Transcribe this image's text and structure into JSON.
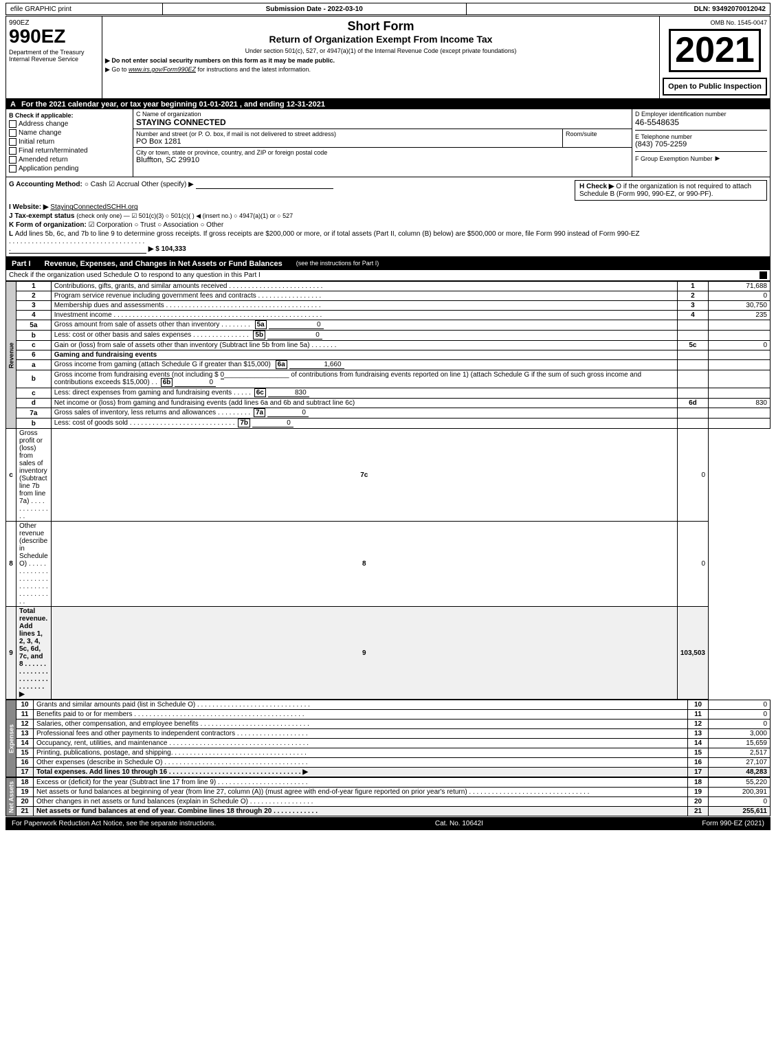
{
  "header": {
    "efile_label": "efile GRAPHIC print",
    "submission_label": "Submission Date - 2022-03-10",
    "dln_label": "DLN: 93492070012042"
  },
  "form_info": {
    "form_number": "990EZ",
    "department": "Department of the Treasury",
    "bureau": "Internal Revenue Service",
    "omb": "OMB No. 1545-0047",
    "year": "2021",
    "title_short": "Short Form",
    "title_long": "Return of Organization Exempt From Income Tax",
    "subtitle": "Under section 501(c), 527, or 4947(a)(1) of the Internal Revenue Code (except private foundations)",
    "note1": "▶ Do not enter social security numbers on this form as it may be made public.",
    "note2": "▶ Go to www.irs.gov/Form990EZ for instructions and the latest information.",
    "open_label": "Open to Public Inspection"
  },
  "section_a": {
    "label": "A",
    "year_text": "For the 2021 calendar year, or tax year beginning 01-01-2021 , and ending 12-31-2021",
    "b_label": "B Check if applicable:",
    "checkboxes": {
      "address_change": "Address change",
      "name_change": "Name change",
      "initial_return": "Initial return",
      "final_return": "Final return/terminated",
      "amended_return": "Amended return",
      "application_pending": "Application pending"
    },
    "c_label": "C Name of organization",
    "org_name": "STAYING CONNECTED",
    "street_label": "Number and street (or P. O. box, if mail is not delivered to street address)",
    "street_value": "PO Box 1281",
    "room_label": "Room/suite",
    "city_label": "City or town, state or province, country, and ZIP or foreign postal code",
    "city_value": "Bluffton, SC  29910",
    "d_label": "D Employer identification number",
    "ein": "46-5548635",
    "e_label": "E Telephone number",
    "phone": "(843) 705-2259",
    "f_label": "F Group Exemption Number",
    "f_arrow": "▶"
  },
  "section_gh": {
    "g_label": "G Accounting Method:",
    "g_cash": "Cash",
    "g_accrual": "Accrual",
    "g_other": "Other (specify) ▶",
    "g_line": "___________________________",
    "h_label": "H  Check ▶",
    "h_text": "O  if the organization is not required to attach Schedule B (Form 990, 990-EZ, or 990-PF).",
    "i_label": "I Website: ▶",
    "i_value": "StayingConnectedSCHH.org",
    "j_label": "J Tax-exempt status",
    "j_text": "(check only one) — ☑ 501(c)(3) ○ 501(c)(    ) ◀ (insert no.) ○ 4947(a)(1) or ○ 527",
    "k_label": "K Form of organization:",
    "k_corp": "☑ Corporation",
    "k_trust": "○ Trust",
    "k_assoc": "○ Association",
    "k_other": "○ Other",
    "l_label": "L",
    "l_text": "Add lines 5b, 6c, and 7b to line 9 to determine gross receipts. If gross receipts are $200,000 or more, or if total assets (Part II, column (B) below) are $500,000 or more, file Form 990 instead of Form 990-EZ",
    "l_value": "▶ $ 104,333"
  },
  "part1": {
    "label": "Part I",
    "title": "Revenue, Expenses, and Changes in Net Assets or Fund Balances",
    "subtitle": "(see the instructions for Part I)",
    "check_text": "Check if the organization used Schedule O to respond to any question in this Part I",
    "rows": [
      {
        "num": "1",
        "desc": "Contributions, gifts, grants, and similar amounts received",
        "col_num": "1",
        "value": "71,688"
      },
      {
        "num": "2",
        "desc": "Program service revenue including government fees and contracts",
        "col_num": "2",
        "value": "0"
      },
      {
        "num": "3",
        "desc": "Membership dues and assessments",
        "col_num": "3",
        "value": "30,750"
      },
      {
        "num": "4",
        "desc": "Investment income",
        "col_num": "4",
        "value": "235"
      },
      {
        "num": "5a",
        "desc": "Gross amount from sale of assets other than inventory",
        "sub_label": "5a",
        "sub_value": "0",
        "col_num": "",
        "value": ""
      },
      {
        "num": "b",
        "desc": "Less: cost or other basis and sales expenses",
        "sub_label": "5b",
        "sub_value": "0",
        "col_num": "",
        "value": ""
      },
      {
        "num": "c",
        "desc": "Gain or (loss) from sale of assets other than inventory (Subtract line 5b from line 5a)",
        "col_num": "5c",
        "value": "0"
      },
      {
        "num": "6",
        "desc": "Gaming and fundraising events",
        "col_num": "",
        "value": ""
      },
      {
        "num": "a",
        "desc": "Gross income from gaming (attach Schedule G if greater than $15,000)",
        "sub_label": "6a",
        "sub_value": "1,660",
        "col_num": "",
        "value": ""
      },
      {
        "num": "b",
        "desc": "Gross income from fundraising events (not including $ 0 _________________ of contributions from fundraising events reported on line 1) (attach Schedule G if the sum of such gross income and contributions exceeds $15,000)",
        "sub_label": "6b",
        "sub_value": "0",
        "col_num": "",
        "value": ""
      },
      {
        "num": "c",
        "desc": "Less: direct expenses from gaming and fundraising events",
        "sub_label": "6c",
        "sub_value": "830",
        "col_num": "",
        "value": ""
      },
      {
        "num": "d",
        "desc": "Net income or (loss) from gaming and fundraising events (add lines 6a and 6b and subtract line 6c)",
        "col_num": "6d",
        "value": "830"
      },
      {
        "num": "7a",
        "desc": "Gross sales of inventory, less returns and allowances",
        "sub_label": "7a",
        "sub_value": "0",
        "col_num": "",
        "value": ""
      },
      {
        "num": "b",
        "desc": "Less: cost of goods sold",
        "sub_label": "7b",
        "sub_value": "0",
        "col_num": "",
        "value": ""
      },
      {
        "num": "c",
        "desc": "Gross profit or (loss) from sales of inventory (Subtract line 7b from line 7a)",
        "col_num": "7c",
        "value": "0"
      },
      {
        "num": "8",
        "desc": "Other revenue (describe in Schedule O)",
        "col_num": "8",
        "value": "0"
      },
      {
        "num": "9",
        "desc": "Total revenue. Add lines 1, 2, 3, 4, 5c, 6d, 7c, and 8",
        "col_num": "9",
        "value": "103,503",
        "is_total": true
      }
    ]
  },
  "expenses": {
    "rows": [
      {
        "num": "10",
        "desc": "Grants and similar amounts paid (list in Schedule O)",
        "col_num": "10",
        "value": "0"
      },
      {
        "num": "11",
        "desc": "Benefits paid to or for members",
        "col_num": "11",
        "value": "0"
      },
      {
        "num": "12",
        "desc": "Salaries, other compensation, and employee benefits",
        "col_num": "12",
        "value": "0"
      },
      {
        "num": "13",
        "desc": "Professional fees and other payments to independent contractors",
        "col_num": "13",
        "value": "3,000"
      },
      {
        "num": "14",
        "desc": "Occupancy, rent, utilities, and maintenance",
        "col_num": "14",
        "value": "15,659"
      },
      {
        "num": "15",
        "desc": "Printing, publications, postage, and shipping.",
        "col_num": "15",
        "value": "2,517"
      },
      {
        "num": "16",
        "desc": "Other expenses (describe in Schedule O)",
        "col_num": "16",
        "value": "27,107"
      },
      {
        "num": "17",
        "desc": "Total expenses. Add lines 10 through 16",
        "col_num": "17",
        "value": "48,283",
        "is_total": true
      }
    ]
  },
  "net_assets": {
    "rows": [
      {
        "num": "18",
        "desc": "Excess or (deficit) for the year (Subtract line 17 from line 9)",
        "col_num": "18",
        "value": "55,220"
      },
      {
        "num": "19",
        "desc": "Net assets or fund balances at beginning of year (from line 27, column (A)) (must agree with end-of-year figure reported on prior year's return)",
        "col_num": "19",
        "value": "200,391"
      },
      {
        "num": "20",
        "desc": "Other changes in net assets or fund balances (explain in Schedule O)",
        "col_num": "20",
        "value": "0"
      },
      {
        "num": "21",
        "desc": "Net assets or fund balances at end of year. Combine lines 18 through 20",
        "col_num": "21",
        "value": "255,611",
        "is_total": true
      }
    ]
  },
  "footer": {
    "paperwork_text": "For Paperwork Reduction Act Notice, see the separate instructions.",
    "cat_num": "Cat. No. 10642I",
    "form_label": "Form 990-EZ (2021)"
  }
}
